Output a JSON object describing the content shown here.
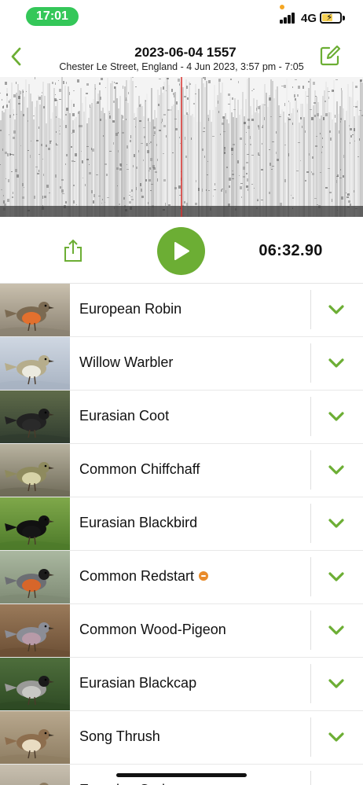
{
  "status_bar": {
    "time": "17:01",
    "network": "4G",
    "icons": [
      "signal-icon",
      "battery-charging-icon"
    ]
  },
  "header": {
    "title": "2023-06-04 1557",
    "subtitle": "Chester Le Street, England - 4 Jun 2023, 3:57 pm - 7:05",
    "back_icon": "chevron-left-icon",
    "edit_icon": "edit-icon"
  },
  "player": {
    "elapsed": "06:32.90",
    "play_icon": "play-icon",
    "share_icon": "share-icon",
    "playhead_color": "#d9302c"
  },
  "accent_color": "#6cae34",
  "species": [
    {
      "name": "European Robin",
      "badge": false
    },
    {
      "name": "Willow Warbler",
      "badge": false
    },
    {
      "name": "Eurasian Coot",
      "badge": false
    },
    {
      "name": "Common Chiffchaff",
      "badge": false
    },
    {
      "name": "Eurasian Blackbird",
      "badge": false
    },
    {
      "name": "Common Redstart",
      "badge": true
    },
    {
      "name": "Common Wood-Pigeon",
      "badge": false
    },
    {
      "name": "Eurasian Blackcap",
      "badge": false
    },
    {
      "name": "Song Thrush",
      "badge": false
    },
    {
      "name": "Eurasian Curlew",
      "badge": false
    }
  ]
}
